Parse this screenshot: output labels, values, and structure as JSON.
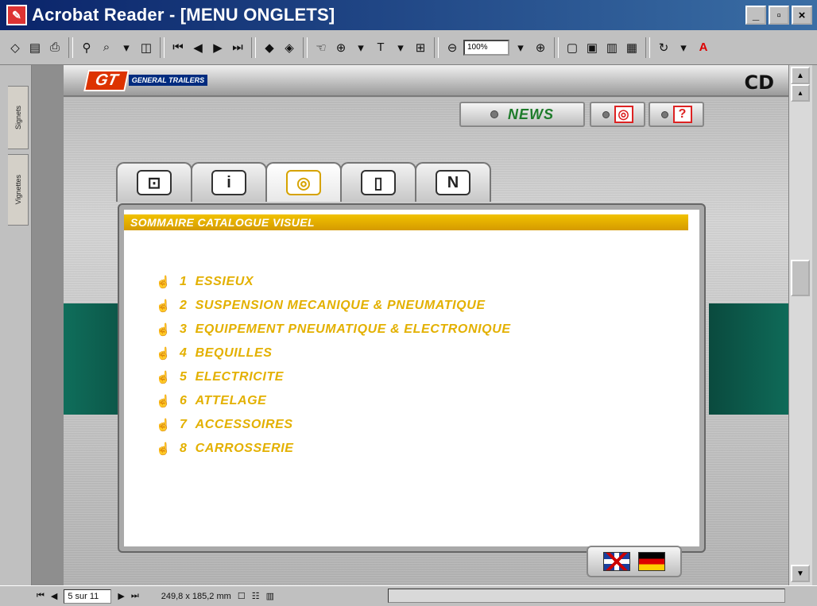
{
  "window": {
    "title": "Acrobat Reader - [MENU ONGLETS]",
    "buttons": {
      "minimize": "_",
      "restore": "▫",
      "close": "×"
    }
  },
  "toolbar": {
    "zoom": "100%"
  },
  "sidebar": {
    "tabs": [
      {
        "label": "Signets"
      },
      {
        "label": "Vignettes"
      }
    ]
  },
  "document": {
    "logo": {
      "main": "GT",
      "sub": "GENERAL TRAILERS"
    },
    "cd_label": "CD",
    "news_label": "NEWS",
    "help_label": "?",
    "panel_title": "SOMMAIRE CATALOGUE VISUEL",
    "menu": [
      {
        "num": "1",
        "label": "ESSIEUX"
      },
      {
        "num": "2",
        "label": "SUSPENSION MECANIQUE & PNEUMATIQUE"
      },
      {
        "num": "3",
        "label": "EQUIPEMENT PNEUMATIQUE & ELECTRONIQUE"
      },
      {
        "num": "4",
        "label": "BEQUILLES"
      },
      {
        "num": "5",
        "label": "ELECTRICITE"
      },
      {
        "num": "6",
        "label": "ATTELAGE"
      },
      {
        "num": "7",
        "label": "ACCESSOIRES"
      },
      {
        "num": "8",
        "label": "CARROSSERIE"
      }
    ],
    "tabs": [
      {
        "icon": "box-icon",
        "glyph": "⊡"
      },
      {
        "icon": "info-icon",
        "glyph": "i"
      },
      {
        "icon": "eye-icon",
        "glyph": "◎"
      },
      {
        "icon": "document-icon",
        "glyph": "▯"
      },
      {
        "icon": "n-icon",
        "glyph": "N"
      }
    ]
  },
  "statusbar": {
    "page": "5 sur 11",
    "size": "249,8 x 185,2 mm"
  },
  "colors": {
    "accent_yellow": "#e3b000",
    "news_green": "#1d7b2a",
    "teal": "#0f6e5b",
    "title_blue": "#0a246a"
  }
}
